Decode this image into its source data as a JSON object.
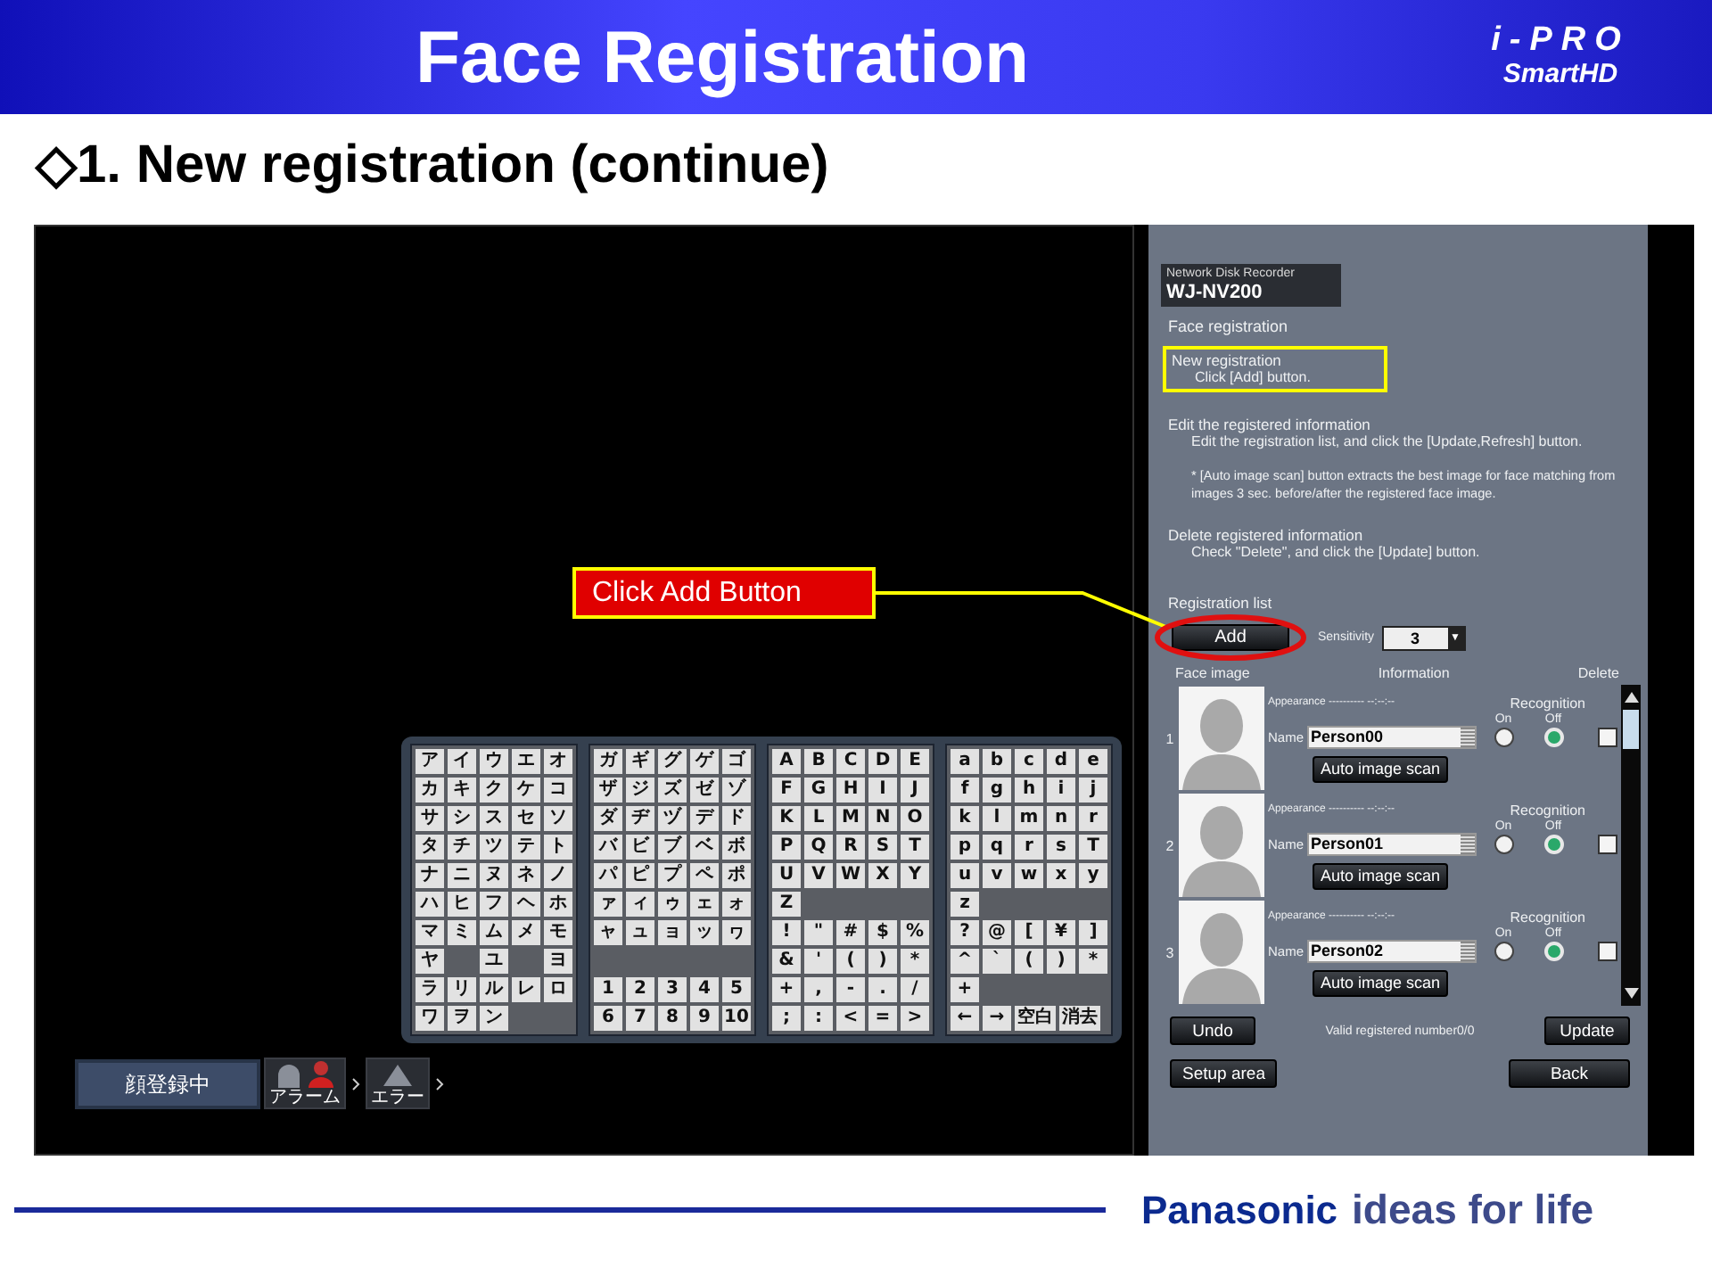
{
  "slide": {
    "title": "Face Registration",
    "brand": "i-PRO",
    "brand_sub": "SmartHD",
    "heading": "◇1. New registration (continue)",
    "footer_brand": "Panasonic",
    "footer_slogan": "ideas for life"
  },
  "callout": {
    "label": "Click Add Button"
  },
  "keyboard": {
    "blocks": [
      [
        {
          "kind": "keys",
          "keys": [
            "ア",
            "イ",
            "ウ",
            "エ",
            "オ"
          ]
        },
        {
          "kind": "keys",
          "keys": [
            "カ",
            "キ",
            "ク",
            "ケ",
            "コ"
          ]
        },
        {
          "kind": "keys",
          "keys": [
            "サ",
            "シ",
            "ス",
            "セ",
            "ソ"
          ]
        },
        {
          "kind": "keys",
          "keys": [
            "タ",
            "チ",
            "ツ",
            "テ",
            "ト"
          ]
        },
        {
          "kind": "keys",
          "keys": [
            "ナ",
            "ニ",
            "ヌ",
            "ネ",
            "ノ"
          ]
        },
        {
          "kind": "keys",
          "keys": [
            "ハ",
            "ヒ",
            "フ",
            "ヘ",
            "ホ"
          ]
        },
        {
          "kind": "keys",
          "keys": [
            "マ",
            "ミ",
            "ム",
            "メ",
            "モ"
          ]
        },
        {
          "kind": "spaced",
          "keys": [
            "ヤ",
            "ユ",
            "ヨ"
          ]
        },
        {
          "kind": "keys",
          "keys": [
            "ラ",
            "リ",
            "ル",
            "レ",
            "ロ"
          ]
        },
        {
          "kind": "keys",
          "keys": [
            "ワ",
            "ヲ",
            "ン"
          ]
        }
      ],
      [
        {
          "kind": "keys",
          "keys": [
            "ガ",
            "ギ",
            "グ",
            "ゲ",
            "ゴ"
          ]
        },
        {
          "kind": "keys",
          "keys": [
            "ザ",
            "ジ",
            "ズ",
            "ゼ",
            "ゾ"
          ]
        },
        {
          "kind": "keys",
          "keys": [
            "ダ",
            "ヂ",
            "ヅ",
            "デ",
            "ド"
          ]
        },
        {
          "kind": "keys",
          "keys": [
            "バ",
            "ビ",
            "ブ",
            "ベ",
            "ボ"
          ]
        },
        {
          "kind": "keys",
          "keys": [
            "パ",
            "ピ",
            "プ",
            "ペ",
            "ポ"
          ]
        },
        {
          "kind": "keys",
          "keys": [
            "ァ",
            "ィ",
            "ゥ",
            "ェ",
            "ォ"
          ]
        },
        {
          "kind": "keys",
          "keys": [
            "ャ",
            "ュ",
            "ョ",
            "ッ",
            "ヮ"
          ]
        },
        {
          "kind": "blank"
        },
        {
          "kind": "keys",
          "keys": [
            "1",
            "2",
            "3",
            "4",
            "5"
          ]
        },
        {
          "kind": "keys",
          "keys": [
            "6",
            "7",
            "8",
            "9",
            "10"
          ]
        }
      ],
      [
        {
          "kind": "keys",
          "keys": [
            "A",
            "B",
            "C",
            "D",
            "E"
          ]
        },
        {
          "kind": "keys",
          "keys": [
            "F",
            "G",
            "H",
            "I",
            "J"
          ]
        },
        {
          "kind": "keys",
          "keys": [
            "K",
            "L",
            "M",
            "N",
            "O"
          ]
        },
        {
          "kind": "keys",
          "keys": [
            "P",
            "Q",
            "R",
            "S",
            "T"
          ]
        },
        {
          "kind": "keys",
          "keys": [
            "U",
            "V",
            "W",
            "X",
            "Y"
          ]
        },
        {
          "kind": "keys",
          "keys": [
            "Z"
          ]
        },
        {
          "kind": "keys",
          "keys": [
            "!",
            "\"",
            "#",
            "$",
            "%"
          ]
        },
        {
          "kind": "keys",
          "keys": [
            "&",
            "'",
            "(",
            ")",
            "*"
          ]
        },
        {
          "kind": "keys",
          "keys": [
            "+",
            ",",
            "-",
            ".",
            "/"
          ]
        },
        {
          "kind": "keys",
          "keys": [
            ";",
            ":",
            "<",
            "=",
            ">"
          ]
        }
      ],
      [
        {
          "kind": "keys",
          "keys": [
            "a",
            "b",
            "c",
            "d",
            "e"
          ]
        },
        {
          "kind": "keys",
          "keys": [
            "f",
            "g",
            "h",
            "i",
            "j"
          ]
        },
        {
          "kind": "keys",
          "keys": [
            "k",
            "l",
            "m",
            "n",
            "r"
          ]
        },
        {
          "kind": "keys",
          "keys": [
            "p",
            "q",
            "r",
            "s",
            "T"
          ]
        },
        {
          "kind": "keys",
          "keys": [
            "u",
            "v",
            "w",
            "x",
            "y"
          ]
        },
        {
          "kind": "keys",
          "keys": [
            "z"
          ]
        },
        {
          "kind": "keys",
          "keys": [
            "?",
            "@",
            "[",
            "¥",
            "]"
          ]
        },
        {
          "kind": "keys",
          "keys": [
            "^",
            "`",
            "(",
            ")",
            "*"
          ]
        },
        {
          "kind": "keys",
          "keys": [
            "+"
          ]
        },
        {
          "kind": "wide",
          "keys": [
            "←",
            "→",
            "空白",
            "消去"
          ]
        }
      ]
    ]
  },
  "status_bar": {
    "mode": "顔登録中",
    "alarm_label": "アラーム",
    "error_label": "エラー"
  },
  "panel": {
    "product_caption": "Network Disk Recorder",
    "product_model": "WJ-NV200",
    "title": "Face registration",
    "sections": [
      {
        "title": "New registration",
        "body": "Click [Add] button.",
        "highlighted": true
      },
      {
        "title": "Edit the registered information",
        "body": "Edit the registration list, and click the [Update,Refresh] button.",
        "note": "* [Auto image scan] button extracts the best image for face matching from images 3 sec. before/after the registered face image.",
        "highlighted": false
      },
      {
        "title": "Delete registered information",
        "body": "Check \"Delete\", and click the [Update] button.",
        "highlighted": false
      }
    ],
    "list_title": "Registration list",
    "add_button": "Add",
    "sensitivity_label": "Sensitivity",
    "sensitivity_value": "3",
    "dropdown_arrow": "▼",
    "columns": [
      "Face image",
      "Information",
      "Delete"
    ],
    "rows": [
      {
        "number": "1",
        "appearance": "Appearance ---------- --:--:--",
        "recognition_label": "Recognition",
        "on_label": "On",
        "off_label": "Off",
        "name_label": "Name",
        "name": "Person00",
        "recognition_on": false,
        "delete": false,
        "scan_button": "Auto image scan"
      },
      {
        "number": "2",
        "appearance": "Appearance ---------- --:--:--",
        "recognition_label": "Recognition",
        "on_label": "On",
        "off_label": "Off",
        "name_label": "Name",
        "name": "Person01",
        "recognition_on": false,
        "delete": false,
        "scan_button": "Auto image scan"
      },
      {
        "number": "3",
        "appearance": "Appearance ---------- --:--:--",
        "recognition_label": "Recognition",
        "on_label": "On",
        "off_label": "Off",
        "name_label": "Name",
        "name": "Person02",
        "recognition_on": false,
        "delete": false,
        "scan_button": "Auto image scan"
      }
    ],
    "undo_button": "Undo",
    "count_text": "Valid registered number0/0",
    "update_button": "Update",
    "setup_button": "Setup area",
    "back_button": "Back"
  }
}
